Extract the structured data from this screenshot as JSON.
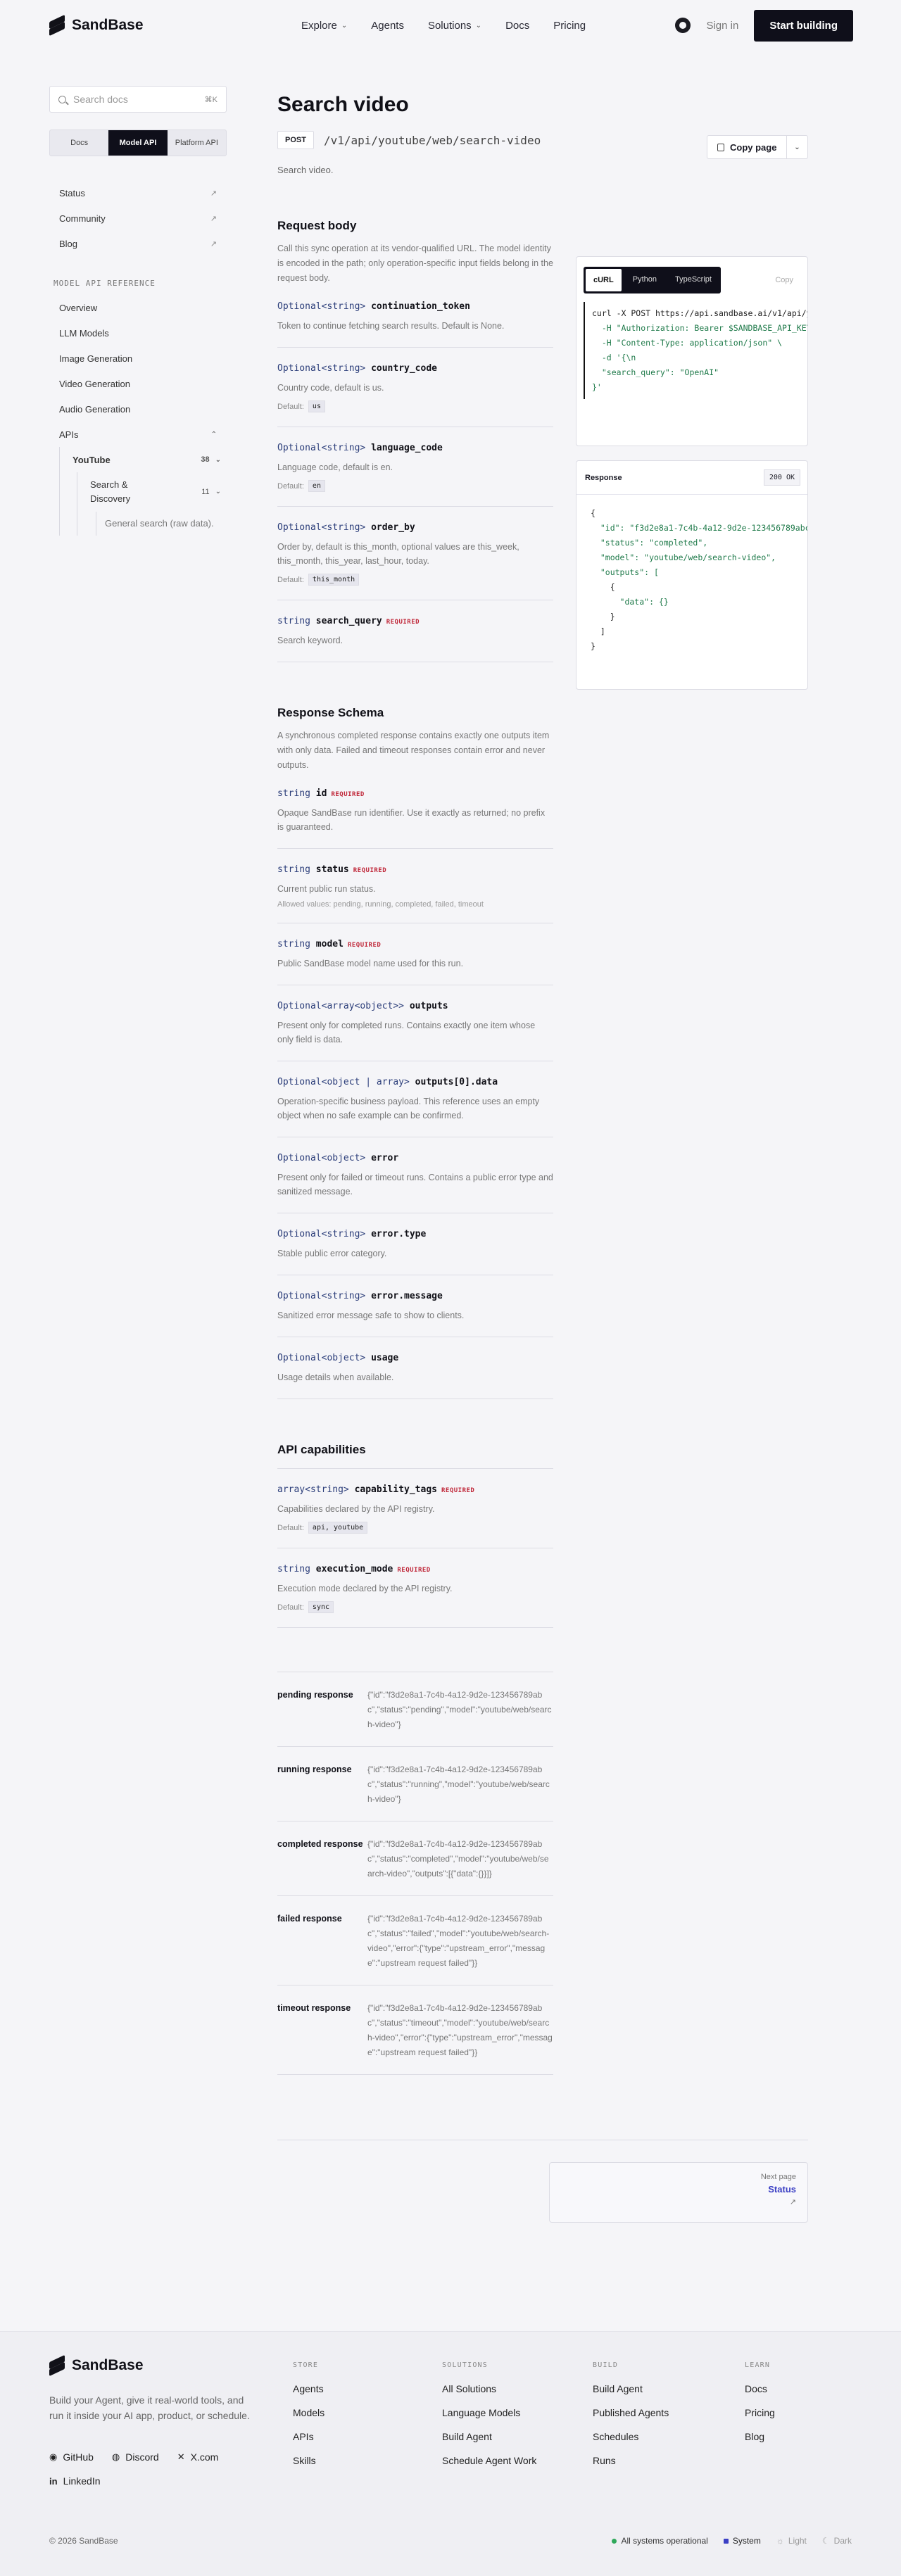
{
  "header": {
    "brand": "SandBase",
    "nav": [
      {
        "label": "Explore",
        "has_caret": true
      },
      {
        "label": "Agents",
        "has_caret": false
      },
      {
        "label": "Solutions",
        "has_caret": true
      },
      {
        "label": "Docs",
        "has_caret": false
      },
      {
        "label": "Pricing",
        "has_caret": false
      }
    ],
    "signin": "Sign in",
    "cta": "Start building"
  },
  "sidebar": {
    "search_placeholder": "Search docs",
    "search_shortcut": "⌘K",
    "segments": [
      "Docs",
      "Model API",
      "Platform API"
    ],
    "active_segment": "Model API",
    "links": [
      "Status",
      "Community",
      "Blog"
    ],
    "reference_heading": "MODEL API REFERENCE",
    "nav": [
      "Overview",
      "LLM Models",
      "Image Generation",
      "Video Generation",
      "Audio Generation",
      "APIs"
    ],
    "apis_child": {
      "label": "YouTube",
      "badge": "38"
    },
    "youtube_child": {
      "label": "Search & Discovery",
      "badge": "11"
    },
    "leaf": "General search (raw data)."
  },
  "page": {
    "title": "Search video",
    "copy_page": "Copy page",
    "method": "POST",
    "path": "/v1/api/youtube/web/search-video",
    "description": "Search video."
  },
  "request_body": {
    "heading": "Request body",
    "intro": "Call this sync operation at its vendor-qualified URL. The model identity is encoded in the path; only operation-specific input fields belong in the request body.",
    "params": [
      {
        "type": "Optional<string>",
        "name": "continuation_token",
        "required": false,
        "desc": "Token to continue fetching search results. Default is None.",
        "default": ""
      },
      {
        "type": "Optional<string>",
        "name": "country_code",
        "required": false,
        "desc": "Country code, default is us.",
        "default": "us"
      },
      {
        "type": "Optional<string>",
        "name": "language_code",
        "required": false,
        "desc": "Language code, default is en.",
        "default": "en"
      },
      {
        "type": "Optional<string>",
        "name": "order_by",
        "required": false,
        "desc": "Order by, default is this_month, optional values are this_week, this_month, this_year, last_hour, today.",
        "default": "this_month"
      },
      {
        "type": "string",
        "name": "search_query",
        "required": true,
        "desc": "Search keyword.",
        "default": ""
      }
    ]
  },
  "response_schema": {
    "heading": "Response Schema",
    "intro": "A synchronous completed response contains exactly one outputs item with only data. Failed and timeout responses contain error and never outputs.",
    "params": [
      {
        "type": "string",
        "name": "id",
        "required": true,
        "desc": "Opaque SandBase run identifier. Use it exactly as returned; no prefix is guaranteed.",
        "allowed": ""
      },
      {
        "type": "string",
        "name": "status",
        "required": true,
        "desc": "Current public run status.",
        "allowed": "Allowed values: pending, running, completed, failed, timeout"
      },
      {
        "type": "string",
        "name": "model",
        "required": true,
        "desc": "Public SandBase model name used for this run.",
        "allowed": ""
      },
      {
        "type": "Optional<array<object>>",
        "name": "outputs",
        "required": false,
        "desc": "Present only for completed runs. Contains exactly one item whose only field is data.",
        "allowed": ""
      },
      {
        "type": "Optional<object | array>",
        "name": "outputs[0].data",
        "required": false,
        "desc": "Operation-specific business payload. This reference uses an empty object when no safe example can be confirmed.",
        "allowed": ""
      },
      {
        "type": "Optional<object>",
        "name": "error",
        "required": false,
        "desc": "Present only for failed or timeout runs. Contains a public error type and sanitized message.",
        "allowed": ""
      },
      {
        "type": "Optional<string>",
        "name": "error.type",
        "required": false,
        "desc": "Stable public error category.",
        "allowed": ""
      },
      {
        "type": "Optional<string>",
        "name": "error.message",
        "required": false,
        "desc": "Sanitized error message safe to show to clients.",
        "allowed": ""
      },
      {
        "type": "Optional<object>",
        "name": "usage",
        "required": false,
        "desc": "Usage details when available.",
        "allowed": ""
      }
    ]
  },
  "capabilities": {
    "heading": "API capabilities",
    "params": [
      {
        "type": "array<string>",
        "name": "capability_tags",
        "required": true,
        "desc": "Capabilities declared by the API registry.",
        "default": "api, youtube"
      },
      {
        "type": "string",
        "name": "execution_mode",
        "required": true,
        "desc": "Execution mode declared by the API registry.",
        "default": "sync"
      }
    ]
  },
  "response_examples": [
    {
      "label": "pending response",
      "value": "{\"id\":\"f3d2e8a1-7c4b-4a12-9d2e-123456789abc\",\"status\":\"pending\",\"model\":\"youtube/web/search-video\"}"
    },
    {
      "label": "running response",
      "value": "{\"id\":\"f3d2e8a1-7c4b-4a12-9d2e-123456789abc\",\"status\":\"running\",\"model\":\"youtube/web/search-video\"}"
    },
    {
      "label": "completed response",
      "value": "{\"id\":\"f3d2e8a1-7c4b-4a12-9d2e-123456789abc\",\"status\":\"completed\",\"model\":\"youtube/web/search-video\",\"outputs\":[{\"data\":{}}]}"
    },
    {
      "label": "failed response",
      "value": "{\"id\":\"f3d2e8a1-7c4b-4a12-9d2e-123456789abc\",\"status\":\"failed\",\"model\":\"youtube/web/search-video\",\"error\":{\"type\":\"upstream_error\",\"message\":\"upstream request failed\"}}"
    },
    {
      "label": "timeout response",
      "value": "{\"id\":\"f3d2e8a1-7c4b-4a12-9d2e-123456789abc\",\"status\":\"timeout\",\"model\":\"youtube/web/search-video\",\"error\":{\"type\":\"upstream_error\",\"message\":\"upstream request failed\"}}"
    }
  ],
  "code": {
    "tabs": [
      "cURL",
      "Python",
      "TypeScript"
    ],
    "active_tab": "cURL",
    "copy": "Copy",
    "curl_lines": [
      "curl -X POST https://api.sandbase.ai/v1/api/y",
      "  -H \"Authorization: Bearer $SANDBASE_API_KEY",
      "  -H \"Content-Type: application/json\" \\",
      "  -d '{\\n",
      "  \"search_query\": \"OpenAI\"",
      "}'"
    ],
    "response_label": "Response",
    "response_status": "200 OK",
    "response_lines": [
      "{",
      "  \"id\": \"f3d2e8a1-7c4b-4a12-9d2e-123456789abc",
      "  \"status\": \"completed\",",
      "  \"model\": \"youtube/web/search-video\",",
      "  \"outputs\": [",
      "    {",
      "      \"data\": {}",
      "    }",
      "  ]",
      "}"
    ]
  },
  "next_page": {
    "label": "Next page",
    "title": "Status",
    "arrow": "↗"
  },
  "footer": {
    "brand": "SandBase",
    "tagline": "Build your Agent, give it real-world tools, and run it inside your AI app, product, or schedule.",
    "social": [
      "GitHub",
      "Discord",
      "X.com",
      "LinkedIn"
    ],
    "columns": [
      {
        "heading": "STORE",
        "items": [
          "Agents",
          "Models",
          "APIs",
          "Skills"
        ]
      },
      {
        "heading": "SOLUTIONS",
        "items": [
          "All Solutions",
          "Language Models",
          "Build Agent",
          "Schedule Agent Work"
        ]
      },
      {
        "heading": "BUILD",
        "items": [
          "Build Agent",
          "Published Agents",
          "Schedules",
          "Runs"
        ]
      },
      {
        "heading": "LEARN",
        "items": [
          "Docs",
          "Pricing",
          "Blog"
        ]
      }
    ],
    "copyright": "© 2026 SandBase",
    "system_status": "All systems operational",
    "themes": [
      "System",
      "Light",
      "Dark"
    ],
    "colors": {
      "status_ok": "#2fa85a",
      "theme_active": "#3b3fc4"
    }
  }
}
